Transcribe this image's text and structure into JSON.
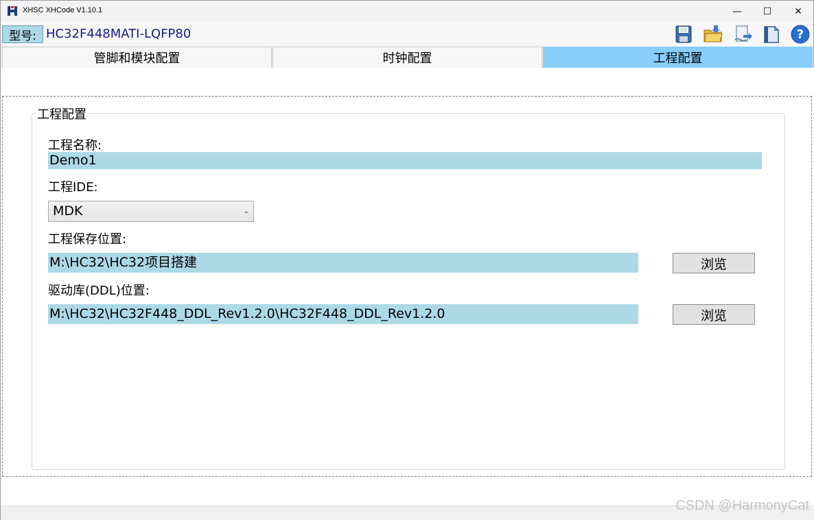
{
  "window": {
    "title": "XHSC XHCode V1.10.1",
    "minimize_glyph": "—",
    "maximize_glyph": "☐",
    "close_glyph": "✕"
  },
  "toolbar": {
    "model_label": "型号:",
    "model_value": "HC32F448MATI-LQFP80",
    "icons": [
      "save-icon",
      "open-folder-icon",
      "export-icon",
      "document-icon",
      "help-icon"
    ],
    "help_glyph": "?"
  },
  "tabs": [
    {
      "label": "管脚和模块配置",
      "active": false
    },
    {
      "label": "时钟配置",
      "active": false
    },
    {
      "label": "工程配置",
      "active": true
    }
  ],
  "project": {
    "group_title": "工程配置",
    "name_label": "工程名称:",
    "name_value": "Demo1",
    "ide_label": "工程IDE:",
    "ide_value": "MDK",
    "save_label": "工程保存位置:",
    "save_path": "M:\\HC32\\HC32项目搭建",
    "ddl_label": "驱动库(DDL)位置:",
    "ddl_path": "M:\\HC32\\HC32F448_DDL_Rev1.2.0\\HC32F448_DDL_Rev1.2.0",
    "browse_label": "浏览"
  },
  "watermark": "CSDN @HarmonyCat",
  "colors": {
    "accent": "#87cefa",
    "field": "#add8e6"
  }
}
